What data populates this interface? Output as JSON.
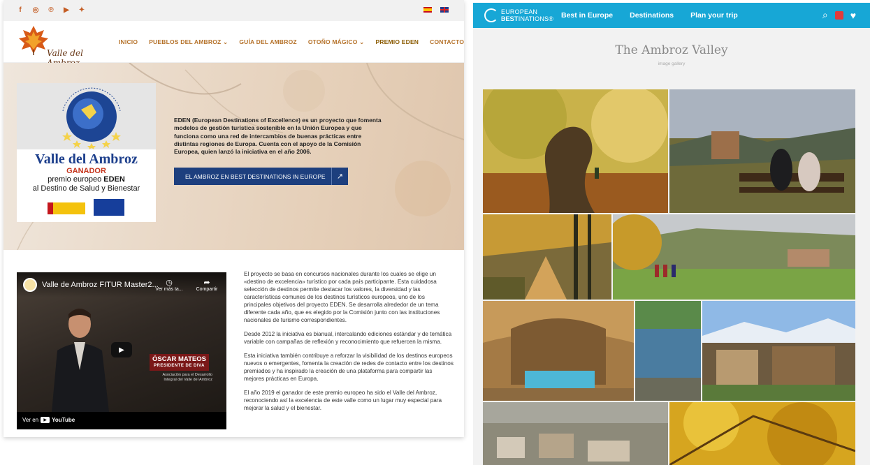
{
  "left": {
    "social_icons": [
      "facebook-icon",
      "instagram-icon",
      "pinterest-icon",
      "youtube-icon",
      "twitter-icon"
    ],
    "social_glyphs": [
      "f",
      "◎",
      "℗",
      "▶",
      "✦"
    ],
    "logo_text": "Valle del Ambroz",
    "nav": [
      "INICIO",
      "PUEBLOS DEL AMBROZ ⌄",
      "GUÍA DEL AMBROZ",
      "OTOÑO MÁGICO ⌄",
      "PREMIO EDEN",
      "CONTACTO ⌄"
    ],
    "eden_card": {
      "title": "Valle del Ambroz",
      "ganador": "GANADOR",
      "line2_prefix": "premio europeo ",
      "line2_bold": "EDEN",
      "line3": "al Destino de Salud y Bienestar"
    },
    "hero_text": "EDEN (European Destinations of Excellence) es un  proyecto que fomenta modelos de gestión turística sostenible en la Unión Europea y que  funciona como una red de intercambios de buenas prácticas entre distintas regiones de Europa. Cuenta con el apoyo de la Comisión Europea, quien lanzó la iniciativa en el año 2006.",
    "hero_button": "EL AMBROZ EN BEST DESTINATIONS IN EUROPE",
    "video": {
      "title": "Valle de Ambroz FITUR Master2...",
      "watch_label": "Ver más ta...",
      "share_label": "Compartir",
      "name": "ÓSCAR MATEOS",
      "role": "PRESIDENTE DE DIVA",
      "assoc": "Asociación para el Desarrollo Integral del Valle del Ambroz",
      "watch_on": "Ver en",
      "youtube": "YouTube"
    },
    "paragraphs": [
      "El proyecto se basa en concursos nacionales durante los cuales se elige un «destino de excelencia» turístico por cada país participante. Esta cuidadosa selección de destinos permite destacar los valores, la diversidad y las características comunes de los destinos turísticos europeos, uno de los principales objetivos del proyecto EDEN. Se desarrolla alrededor de un tema diferente cada año, que es elegido por la Comisión junto con las instituciones nacionales de turismo correspondientes.",
      "Desde 2012 la iniciativa es bianual, intercalando ediciones estándar y de temática variable con campañas de reflexión y reconocimiento que refuercen la misma.",
      "Esta iniciativa también contribuye a reforzar la visibilidad de los destinos europeos nuevos o emergentes, fomenta la creación de redes de contacto entre los destinos premiados y ha inspirado la creación de una plataforma para compartir las mejores prácticas en Europa.",
      "El año 2019 el ganador de este premio europeo ha sido el Valle del Ambroz, reconociendo así la excelencia de este valle como un lugar muy especial para mejorar la salud y el bienestar."
    ]
  },
  "right": {
    "logo_line1": "EUROPEAN BEST",
    "logo_line2": "DESTINATIONS®",
    "nav": [
      "Best in Europe",
      "Destinations",
      "Plan your trip"
    ],
    "gallery_title": "The Ambroz Valley",
    "gallery_subtitle": "image gallery"
  }
}
